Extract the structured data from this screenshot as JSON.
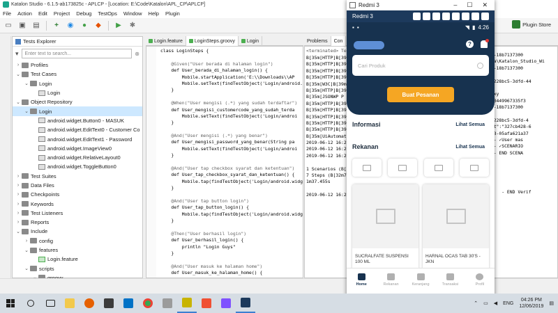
{
  "window": {
    "title": "Katalon Studio - 6.1.5-ab173825c - APLCP - [Location: E:\\Code\\Katalon\\APL_CP\\APLCP]"
  },
  "menu": [
    "File",
    "Action",
    "Edit",
    "Project",
    "Debug",
    "TestOps",
    "Window",
    "Help",
    "Plugin"
  ],
  "toolbar": {
    "plugin_store_label": "Plugin Store"
  },
  "explorer": {
    "title": "Tests Explorer",
    "search_placeholder": "Enter text to search...",
    "items": [
      {
        "label": "Profiles",
        "depth": 0,
        "arrow": "›",
        "kind": "folder"
      },
      {
        "label": "Test Cases",
        "depth": 0,
        "arrow": "⌄",
        "kind": "folder"
      },
      {
        "label": "Login",
        "depth": 1,
        "arrow": "⌄",
        "kind": "folder"
      },
      {
        "label": "Login",
        "depth": 2,
        "arrow": "",
        "kind": "file"
      },
      {
        "label": "Object Repository",
        "depth": 0,
        "arrow": "⌄",
        "kind": "folder"
      },
      {
        "label": "Login",
        "depth": 1,
        "arrow": "⌄",
        "kind": "folder",
        "selected": true
      },
      {
        "label": "android.widget.Button0 - MASUK",
        "depth": 2,
        "arrow": "",
        "kind": "file"
      },
      {
        "label": "android.widget.EditText0 - Customer Co",
        "depth": 2,
        "arrow": "",
        "kind": "file"
      },
      {
        "label": "android.widget.EditText1 - Password",
        "depth": 2,
        "arrow": "",
        "kind": "file"
      },
      {
        "label": "android.widget.ImageView0",
        "depth": 2,
        "arrow": "",
        "kind": "file"
      },
      {
        "label": "android.widget.RelativeLayout0",
        "depth": 2,
        "arrow": "",
        "kind": "file"
      },
      {
        "label": "android.widget.ToggleButton0",
        "depth": 2,
        "arrow": "",
        "kind": "file"
      },
      {
        "label": "Test Suites",
        "depth": 0,
        "arrow": "›",
        "kind": "folder"
      },
      {
        "label": "Data Files",
        "depth": 0,
        "arrow": "›",
        "kind": "folder"
      },
      {
        "label": "Checkpoints",
        "depth": 0,
        "arrow": "›",
        "kind": "folder"
      },
      {
        "label": "Keywords",
        "depth": 0,
        "arrow": "›",
        "kind": "folder"
      },
      {
        "label": "Test Listeners",
        "depth": 0,
        "arrow": "›",
        "kind": "folder"
      },
      {
        "label": "Reports",
        "depth": 0,
        "arrow": "›",
        "kind": "folder"
      },
      {
        "label": "Include",
        "depth": 0,
        "arrow": "⌄",
        "kind": "folder"
      },
      {
        "label": "config",
        "depth": 1,
        "arrow": "›",
        "kind": "folder"
      },
      {
        "label": "features",
        "depth": 1,
        "arrow": "⌄",
        "kind": "folder"
      },
      {
        "label": "Login.feature",
        "depth": 2,
        "arrow": "",
        "kind": "green-file"
      },
      {
        "label": "scripts",
        "depth": 1,
        "arrow": "⌄",
        "kind": "folder"
      },
      {
        "label": "groovy",
        "depth": 2,
        "arrow": "⌄",
        "kind": "folder"
      }
    ]
  },
  "editor": {
    "tabs": [
      "Login.feature",
      "LoginSteps.groovy",
      "Login"
    ],
    "active_tab": 1,
    "lines": [
      {
        "t": "class LoginSteps {",
        "c": "plain"
      },
      {
        "t": "",
        "c": "plain"
      },
      {
        "t": "    @Given(\"User berada di halaman login\")",
        "c": "ann"
      },
      {
        "t": "    def User_berada_di_halaman_login() {",
        "c": "plain"
      },
      {
        "t": "        Mobile.startApplication('E:\\\\Downloads\\\\AP",
        "c": "plain"
      },
      {
        "t": "        Mobile.setText(findTestObject('Login/android.",
        "c": "plain"
      },
      {
        "t": "    }",
        "c": "plain"
      },
      {
        "t": "",
        "c": "plain"
      },
      {
        "t": "    @When(\"User mengisi (.*) yang sudah terdaftar\")",
        "c": "ann"
      },
      {
        "t": "    def User_mengisi_customercode_yang_sudah_terda",
        "c": "plain"
      },
      {
        "t": "        Mobile.setText(findTestObject('Login/androi",
        "c": "plain"
      },
      {
        "t": "    }",
        "c": "plain"
      },
      {
        "t": "",
        "c": "plain"
      },
      {
        "t": "    @And(\"User mengisi (.*) yang benar\")",
        "c": "ann"
      },
      {
        "t": "    def User_mengisi_password_yang_benar(String pa",
        "c": "plain"
      },
      {
        "t": "        Mobile.setText(findTestObject('Login/androi",
        "c": "plain"
      },
      {
        "t": "    }",
        "c": "plain"
      },
      {
        "t": "",
        "c": "plain"
      },
      {
        "t": "    @And(\"User tap checkbox syarat dan ketentuan\")",
        "c": "ann"
      },
      {
        "t": "    def User_tap_checkbox_syarat_dan_ketentuan() {",
        "c": "plain"
      },
      {
        "t": "        Mobile.tap(findTestObject('Login/android.widget",
        "c": "plain"
      },
      {
        "t": "    }",
        "c": "plain"
      },
      {
        "t": "",
        "c": "plain"
      },
      {
        "t": "    @And(\"User tap button login\")",
        "c": "ann"
      },
      {
        "t": "    def User_tap_button_login() {",
        "c": "plain"
      },
      {
        "t": "        Mobile.tap(findTestObject('Login/android.widget.Button0 -",
        "c": "plain"
      },
      {
        "t": "    }",
        "c": "plain"
      },
      {
        "t": "",
        "c": "plain"
      },
      {
        "t": "    @Then(\"User berhasil login\")",
        "c": "ann"
      },
      {
        "t": "    def User_berhasil_login() {",
        "c": "plain"
      },
      {
        "t": "        println \"Login Guys\"",
        "c": "plain"
      },
      {
        "t": "    }",
        "c": "plain"
      },
      {
        "t": "",
        "c": "plain"
      },
      {
        "t": "    @And(\"User masuk ke halaman home\")",
        "c": "ann"
      },
      {
        "t": "    def User_masuk_ke_halaman_home() {",
        "c": "plain"
      },
      {
        "t": "        Mobile.tap(findTestObject('Login/android.widget.Relativ",
        "c": "plain"
      },
      {
        "t": "    }",
        "c": "plain"
      },
      {
        "t": "}",
        "c": "plain"
      }
    ]
  },
  "console": {
    "tabs": [
      "Problems",
      "Con"
    ],
    "terminated": "<terminated> Temp",
    "lines": [
      "B[35m[HTTP]B[39",
      "B[35m[HTTP]B[39",
      "B[35m[HTTP]B[39",
      "B[35m[HTTP]B[39",
      "B[35m[W3C]B[39m",
      "B[35m[HTTP]B[39",
      "B[35m[JSONWP P",
      "B[35m[HTTP]B[39",
      "B[35m[HTTP]B[39",
      "B[35m[HTTP]B[39",
      "B[35m[HTTP]B[39",
      "B[35m[HTTP]B[39",
      "B[35m[UiAutomat",
      "2019-06-12 16:2",
      "2019-06-12 16:2",
      "2019-06-12 16:2",
      "",
      "1 Scenarios (B[",
      "7 Steps (B[32m7",
      "1m37.455s",
      "",
      "2019-06-12 16:2"
    ],
    "right_lines": [
      "0b-18b7137300",
      "aja\\Katalon_Studio_Wi",
      "0b-18b7137300",
      "",
      "0e228bc5-3dfd-44",
      "",
      "roxy",
      "4-3449967335f3",
      "0b-18b7137300",
      "",
      "0e228bc5-3dfd-4",
      "ent\":\"327cb428-6",
      "a93-05afa621a37",
      "  - ✓User mas",
      "  - ✓SCENARIO",
      "  - END SCENA",
      "",
      "",
      "",
      "",
      "",
      "r    - END Verif"
    ]
  },
  "phone": {
    "window_title": "Redmi 3",
    "device_label": "Redmi 3",
    "time": "4:26",
    "search_placeholder": "Cari Produk",
    "order_button": "Buat Pesanan",
    "info_title": "Informasi",
    "info_link": "Lihat Semua",
    "partner_title": "Rekanan",
    "partner_link": "Lihat Semua",
    "products": [
      "SUCRALFATE SUSPENSI 100 ML",
      "HARNAL OCAS TAB 30'S - JKN"
    ],
    "nav": [
      "Home",
      "Rekanan",
      "Keranjang",
      "Transaksi",
      "Profil"
    ],
    "accent": "#f5a623",
    "primary": "#17324f"
  },
  "taskbar": {
    "lang": "ENG",
    "time": "04:26 PM",
    "date": "12/06/2019"
  }
}
